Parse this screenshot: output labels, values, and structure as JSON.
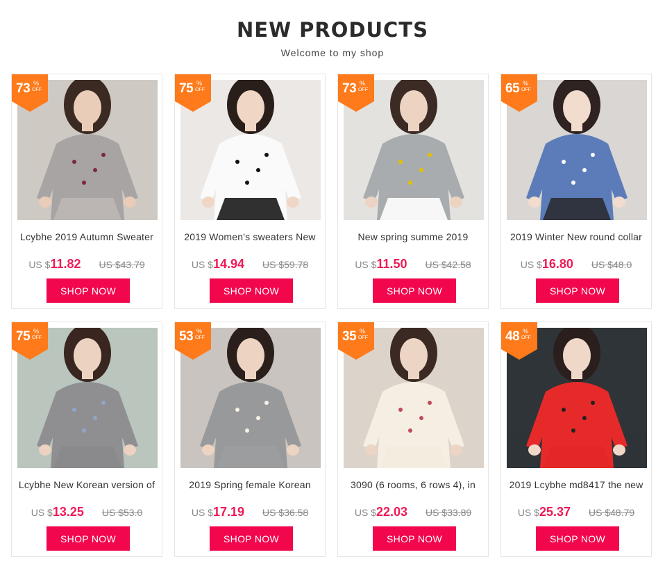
{
  "header": {
    "title": "NEW PRODUCTS",
    "subtitle": "Welcome to my shop",
    "highlight_color": "#f7dbe3"
  },
  "colors": {
    "badge": "#ff7a1a",
    "price": "#ee1a55",
    "button": "#f2064c"
  },
  "products": [
    {
      "discount": "73",
      "pct": "%",
      "off": "OFF",
      "name": "Lcybhe 2019 Autumn Sweater",
      "currency": "US $",
      "price": "11.82",
      "old_price": "US $43.79",
      "button": "SHOP NOW",
      "image": "gray-embroidered-sweater"
    },
    {
      "discount": "75",
      "pct": "%",
      "off": "OFF",
      "name": "2019 Women's sweaters New",
      "currency": "US $",
      "price": "14.94",
      "old_price": "US $59.78",
      "button": "SHOP NOW",
      "image": "white-bow-sleeve-sweater"
    },
    {
      "discount": "73",
      "pct": "%",
      "off": "OFF",
      "name": "New spring summe 2019",
      "currency": "US $",
      "price": "11.50",
      "old_price": "US $42.58",
      "button": "SHOP NOW",
      "image": "gray-cardigan"
    },
    {
      "discount": "65",
      "pct": "%",
      "off": "OFF",
      "name": "2019 Winter New round collar",
      "currency": "US $",
      "price": "16.80",
      "old_price": "US $48.0",
      "button": "SHOP NOW",
      "image": "blue-letter-sweater"
    },
    {
      "discount": "75",
      "pct": "%",
      "off": "OFF",
      "name": "Lcybhe New Korean version of",
      "currency": "US $",
      "price": "13.25",
      "old_price": "US $53.0",
      "button": "SHOP NOW",
      "image": "gray-knit-dress"
    },
    {
      "discount": "53",
      "pct": "%",
      "off": "OFF",
      "name": "2019 Spring female Korean",
      "currency": "US $",
      "price": "17.19",
      "old_price": "US $36.58",
      "button": "SHOP NOW",
      "image": "gray-knit-set"
    },
    {
      "discount": "35",
      "pct": "%",
      "off": "OFF",
      "name": "3090 (6 rooms, 6 rows 4), in",
      "currency": "US $",
      "price": "22.03",
      "old_price": "US $33.89",
      "button": "SHOP NOW",
      "image": "white-floral-dress"
    },
    {
      "discount": "48",
      "pct": "%",
      "off": "OFF",
      "name": "2019 Lcybhe md8417 the new",
      "currency": "US $",
      "price": "25.37",
      "old_price": "US $48.79",
      "button": "SHOP NOW",
      "image": "red-sweater-dress"
    }
  ]
}
